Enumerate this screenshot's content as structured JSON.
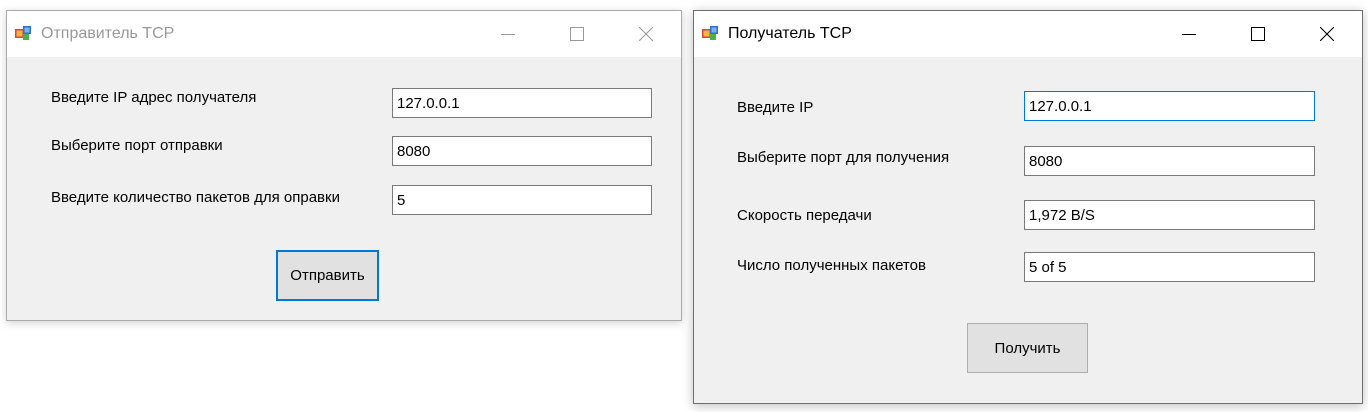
{
  "sender": {
    "title": "Отправитель TCP",
    "fields": [
      {
        "label": "Введите IP адрес получателя",
        "value": "127.0.0.1"
      },
      {
        "label": "Выберите порт отправки",
        "value": "8080"
      },
      {
        "label": "Введите количество пакетов для оправки",
        "value": "5"
      }
    ],
    "send_button": "Отправить"
  },
  "receiver": {
    "title": "Получатель TCP",
    "fields": [
      {
        "label": "Введите IP",
        "value": "127.0.0.1"
      },
      {
        "label": "Выберите порт для получения",
        "value": "8080"
      },
      {
        "label": "Скорость передачи",
        "value": "1,972 B/S"
      },
      {
        "label": "Число полученных пакетов",
        "value": "5 of 5"
      }
    ],
    "receive_button": "Получить"
  },
  "icons": {
    "app": "app-icon",
    "minimize": "minimize-icon",
    "maximize": "maximize-icon",
    "close": "close-icon"
  },
  "colors": {
    "window_bg": "#f0f0f0",
    "focus_accent": "#0078d7",
    "inactive_title": "#999999"
  }
}
